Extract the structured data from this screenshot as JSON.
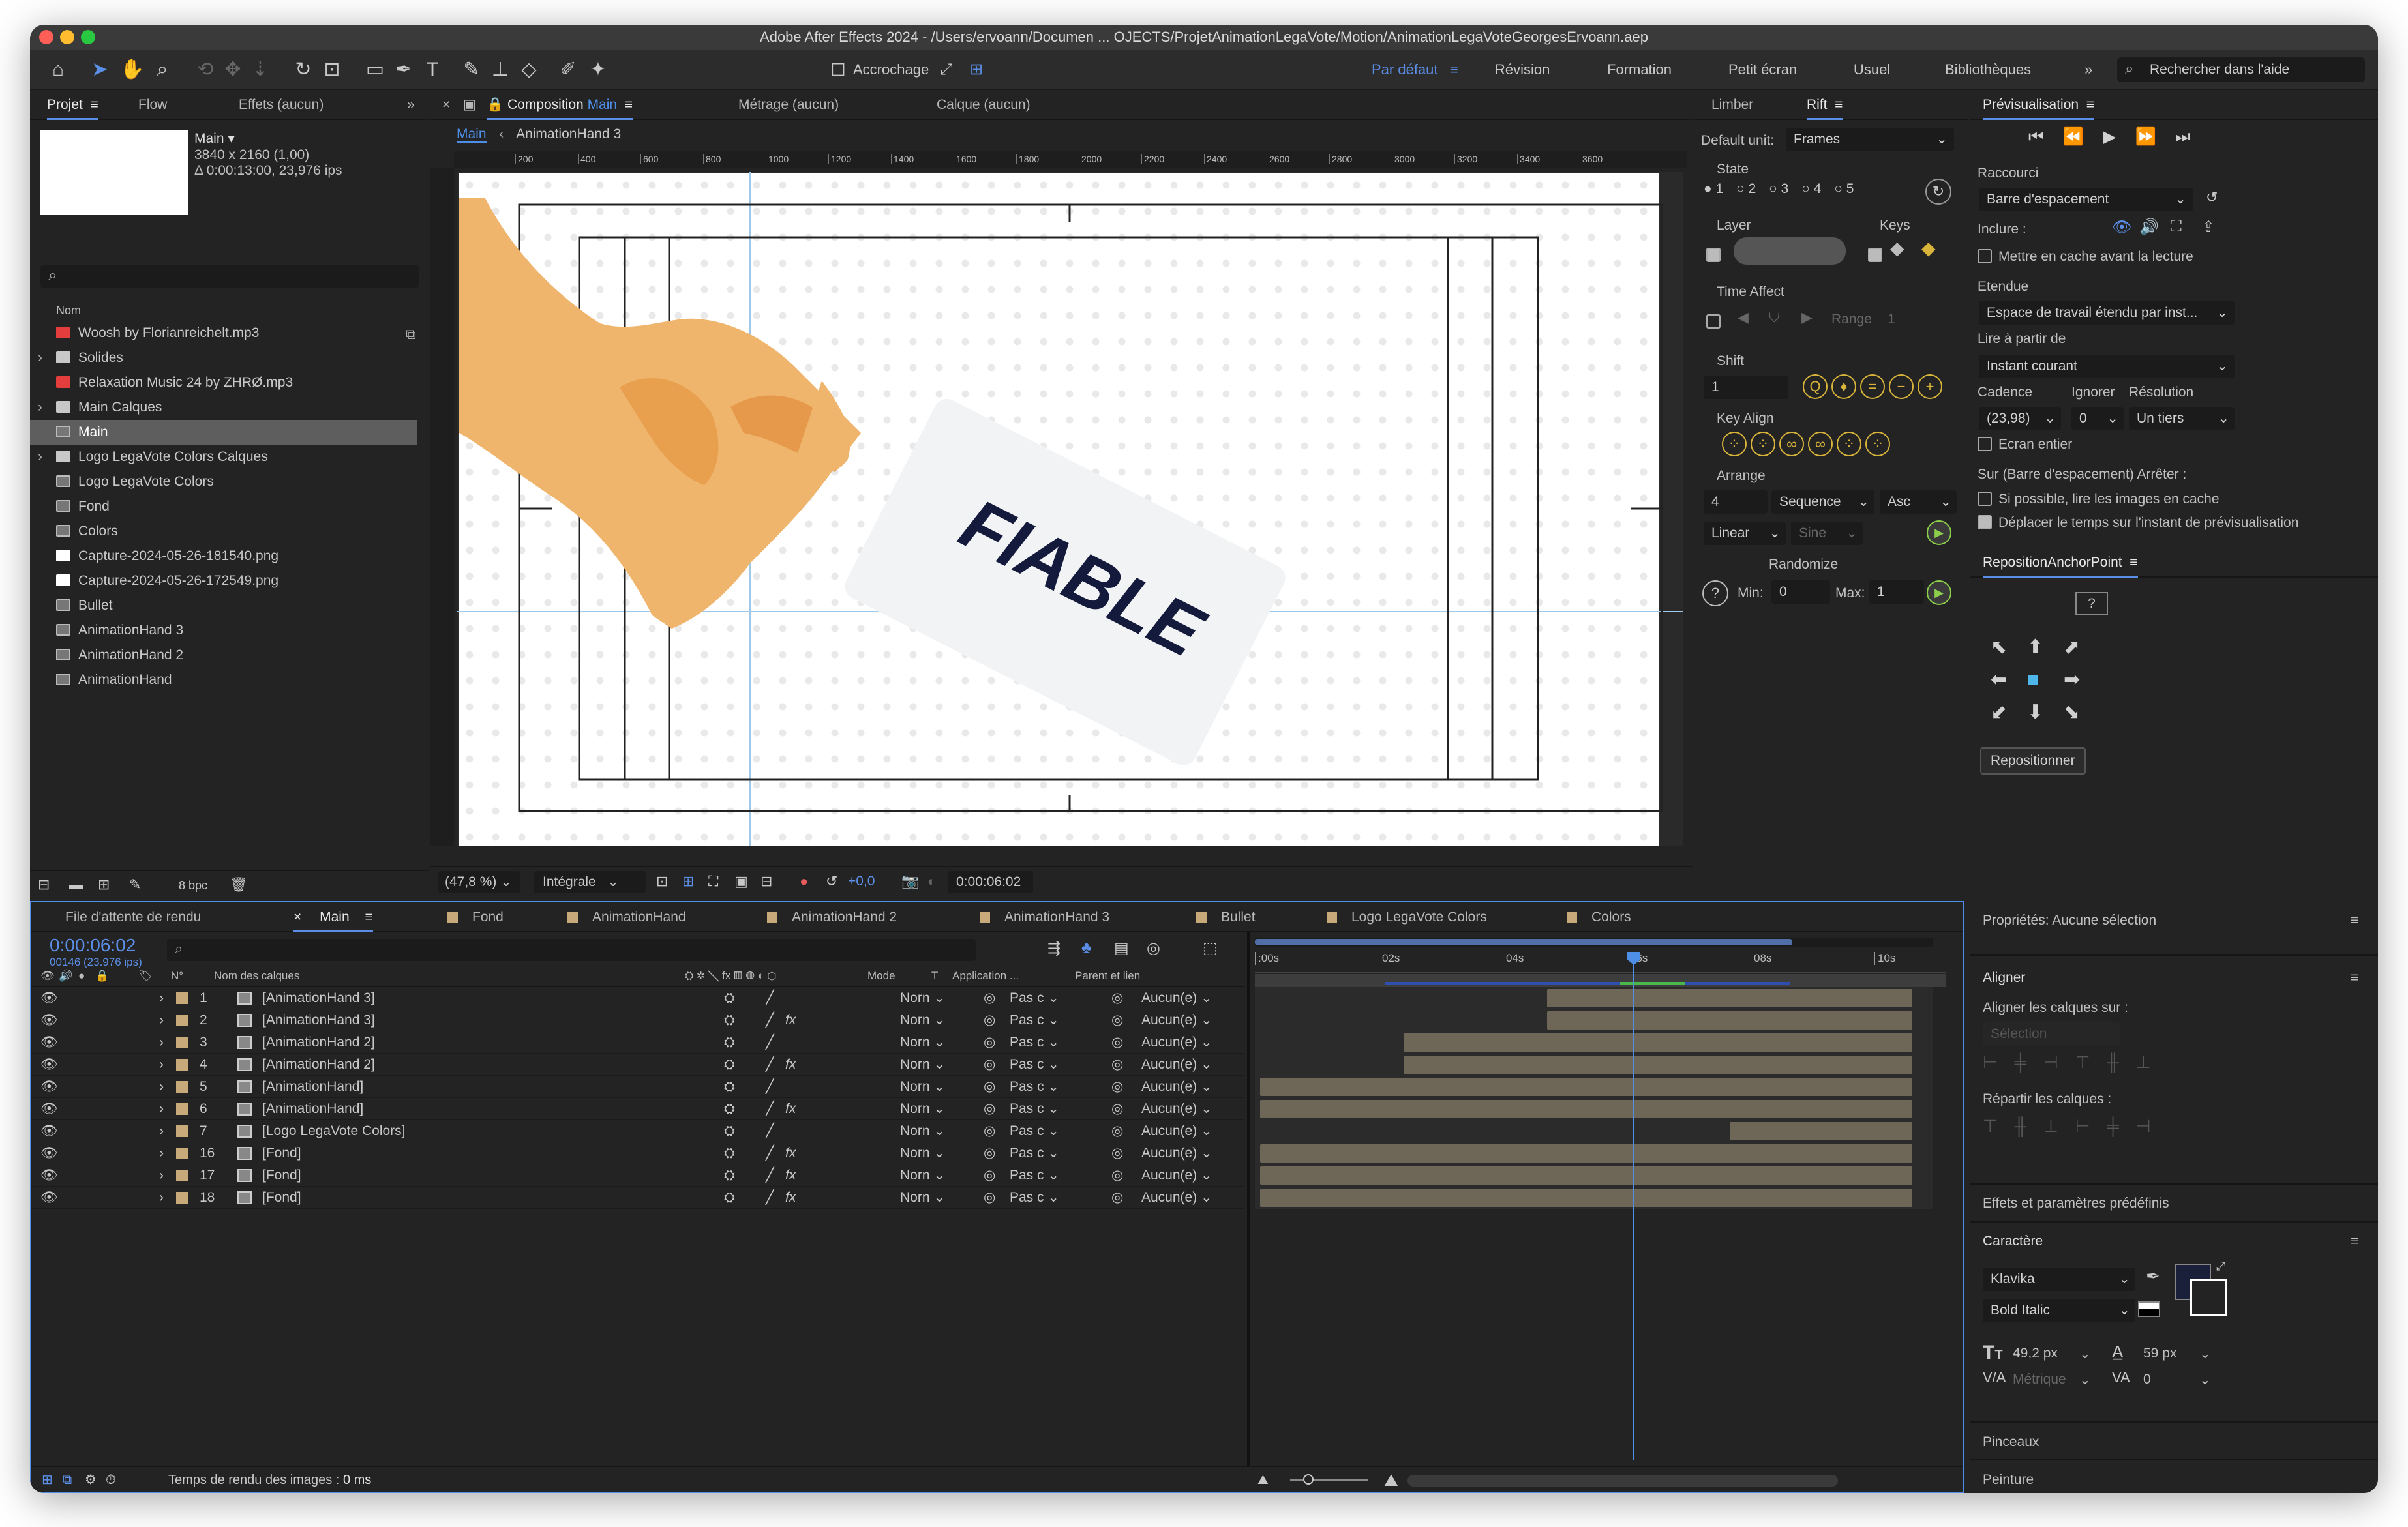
{
  "window": {
    "title": "Adobe After Effects 2024 - /Users/ervoann/Documen ... OJECTS/ProjetAnimationLegaVote/Motion/AnimationLegaVoteGeorgesErvoann.aep"
  },
  "toolbar": {
    "snap_label": "Accrochage",
    "workspaces": [
      "Par défaut",
      "Révision",
      "Formation",
      "Petit écran",
      "Usuel",
      "Bibliothèques"
    ],
    "active_workspace": "Par défaut",
    "search_placeholder": "Rechercher dans l'aide"
  },
  "project": {
    "tabs": [
      "Projet",
      "Flow",
      "Effets (aucun)"
    ],
    "comp_name": "Main ▾",
    "comp_info1": "3840 x 2160 (1,00)",
    "comp_info2": "Δ 0:00:13:00, 23,976 ips",
    "col_header": "Nom",
    "items": [
      {
        "name": "Woosh by Florianreichelt.mp3",
        "type": "audio"
      },
      {
        "name": "Solides",
        "type": "folder"
      },
      {
        "name": "Relaxation Music 24 by ZHRØ.mp3",
        "type": "audio"
      },
      {
        "name": "Main Calques",
        "type": "folder"
      },
      {
        "name": "Main",
        "type": "comp"
      },
      {
        "name": "Logo LegaVote Colors Calques",
        "type": "folder"
      },
      {
        "name": "Logo LegaVote Colors",
        "type": "comp"
      },
      {
        "name": "Fond",
        "type": "comp"
      },
      {
        "name": "Colors",
        "type": "comp"
      },
      {
        "name": "Capture-2024-05-26-181540.png",
        "type": "image"
      },
      {
        "name": "Capture-2024-05-26-172549.png",
        "type": "image"
      },
      {
        "name": "Bullet",
        "type": "comp"
      },
      {
        "name": "AnimationHand 3",
        "type": "comp"
      },
      {
        "name": "AnimationHand 2",
        "type": "comp"
      },
      {
        "name": "AnimationHand",
        "type": "comp"
      }
    ],
    "bpc": "8 bpc"
  },
  "composition": {
    "tab_prefix": "Composition",
    "tab_name": "Main",
    "other_tabs": [
      "Métrage (aucun)",
      "Calque (aucun)"
    ],
    "breadcrumbs": [
      "Main",
      "AnimationHand 3"
    ],
    "ruler": [
      "200",
      "400",
      "600",
      "800",
      "1000",
      "1200",
      "1400",
      "1600",
      "1800",
      "2000",
      "2200",
      "2400",
      "2600",
      "2800",
      "3000",
      "3200",
      "3400",
      "3600"
    ],
    "card_text": "FIABLE",
    "zoom": "(47,8 %)",
    "resolution": "Intégrale",
    "exposure": "+0,0",
    "timecode": "0:00:06:02"
  },
  "rift": {
    "tabs": [
      "Limber",
      "Rift"
    ],
    "default_unit_label": "Default unit:",
    "default_unit": "Frames",
    "state_label": "State",
    "states": [
      "1",
      "2",
      "3",
      "4",
      "5"
    ],
    "layer_label": "Layer",
    "keys_label": "Keys",
    "time_affect": "Time Affect",
    "range": "Range",
    "range_val": "1",
    "shift": "Shift",
    "shift_val": "1",
    "key_align": "Key Align",
    "arrange": "Arrange",
    "arrange_val": "4",
    "sequence": "Sequence",
    "asc": "Asc",
    "linear": "Linear",
    "sine": "Sine",
    "randomize": "Randomize",
    "min_label": "Min:",
    "min_val": "0",
    "max_label": "Max:",
    "max_val": "1"
  },
  "preview": {
    "title": "Prévisualisation",
    "shortcut_label": "Raccourci",
    "shortcut": "Barre d'espacement",
    "include": "Inclure :",
    "cache": "Mettre en cache avant la lecture",
    "range_label": "Etendue",
    "range": "Espace de travail étendu par inst...",
    "play_from_label": "Lire à partir de",
    "play_from": "Instant courant",
    "cadence_label": "Cadence",
    "ignore_label": "Ignorer",
    "resolution_label": "Résolution",
    "cadence": "(23,98)",
    "ignore": "0",
    "resolution": "Un tiers",
    "fullscreen": "Ecran entier",
    "stop_label": "Sur (Barre d'espacement) Arrêter :",
    "stop_opt1": "Si possible, lire les images en cache",
    "stop_opt2": "Déplacer le temps sur l'instant de prévisualisation"
  },
  "anchor": {
    "title": "RepositionAnchorPoint",
    "help": "?",
    "button": "Repositionner"
  },
  "properties": {
    "title": "Propriétés: Aucune sélection"
  },
  "align": {
    "title": "Aligner",
    "align_to": "Aligner les calques sur :",
    "selection": "Sélection",
    "distribute": "Répartir les calques :"
  },
  "effects": {
    "title": "Effets et paramètres prédéfinis"
  },
  "character": {
    "title": "Caractère",
    "font": "Klavika",
    "style": "Bold Italic",
    "size": "49,2 px",
    "leading": "59 px",
    "kerning": "Métrique",
    "tracking": "0",
    "fill_color": "#1a1f3a"
  },
  "brushes": {
    "title": "Pinceaux"
  },
  "paint": {
    "title": "Peinture"
  },
  "timeline": {
    "tabs": [
      "File d'attente de rendu",
      "Main",
      "Fond",
      "AnimationHand",
      "AnimationHand 2",
      "AnimationHand 3",
      "Bullet",
      "Logo LegaVote Colors",
      "Colors"
    ],
    "timecode": "0:00:06:02",
    "frames": "00146 (23.976 ips)",
    "col_num": "N°",
    "col_name": "Nom des calques",
    "col_mode": "Mode",
    "col_t": "T",
    "col_app": "Application ...",
    "col_parent": "Parent et lien",
    "time_marks": [
      ":00s",
      "02s",
      "04s",
      "06s",
      "08s",
      "10s"
    ],
    "layers": [
      {
        "num": "1",
        "name": "[AnimationHand 3]",
        "fx": false,
        "mode": "Norn",
        "app": "Pas c",
        "parent": "Aucun(e)",
        "start": 0.44,
        "end": 1.0
      },
      {
        "num": "2",
        "name": "[AnimationHand 3]",
        "fx": true,
        "mode": "Norn",
        "app": "Pas c",
        "parent": "Aucun(e)",
        "start": 0.44,
        "end": 1.0
      },
      {
        "num": "3",
        "name": "[AnimationHand 2]",
        "fx": false,
        "mode": "Norn",
        "app": "Pas c",
        "parent": "Aucun(e)",
        "start": 0.22,
        "end": 1.0
      },
      {
        "num": "4",
        "name": "[AnimationHand 2]",
        "fx": true,
        "mode": "Norn",
        "app": "Pas c",
        "parent": "Aucun(e)",
        "start": 0.22,
        "end": 1.0
      },
      {
        "num": "5",
        "name": "[AnimationHand]",
        "fx": false,
        "mode": "Norn",
        "app": "Pas c",
        "parent": "Aucun(e)",
        "start": 0.0,
        "end": 1.0
      },
      {
        "num": "6",
        "name": "[AnimationHand]",
        "fx": true,
        "mode": "Norn",
        "app": "Pas c",
        "parent": "Aucun(e)",
        "start": 0.0,
        "end": 1.0
      },
      {
        "num": "7",
        "name": "[Logo LegaVote Colors]",
        "fx": false,
        "mode": "Norn",
        "app": "Pas c",
        "parent": "Aucun(e)",
        "start": 0.72,
        "end": 1.0
      },
      {
        "num": "16",
        "name": "[Fond]",
        "fx": true,
        "mode": "Norn",
        "app": "Pas c",
        "parent": "Aucun(e)",
        "start": 0.0,
        "end": 1.0
      },
      {
        "num": "17",
        "name": "[Fond]",
        "fx": true,
        "mode": "Norn",
        "app": "Pas c",
        "parent": "Aucun(e)",
        "start": 0.0,
        "end": 1.0
      },
      {
        "num": "18",
        "name": "[Fond]",
        "fx": true,
        "mode": "Norn",
        "app": "Pas c",
        "parent": "Aucun(e)",
        "start": 0.0,
        "end": 1.0
      }
    ],
    "render_time_label": "Temps de rendu des images :",
    "render_time": "0 ms"
  },
  "colors": {
    "accent": "#4f8ee6",
    "hand": "#efb36a",
    "hand_shade": "#e59b4b",
    "card": "#f2f3f5",
    "card_text": "#141a3c",
    "bar": "#6e6657"
  }
}
